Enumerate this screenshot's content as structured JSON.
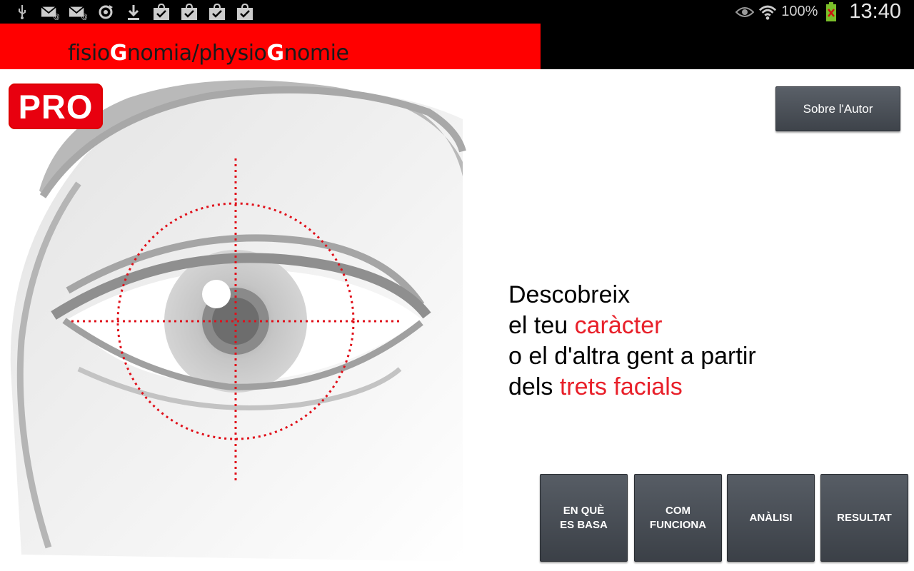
{
  "status_bar": {
    "left_icons": [
      "usb-icon",
      "email-icon",
      "email-icon",
      "sync-icon",
      "download-icon",
      "bag-check-icon",
      "bag-check-icon",
      "bag-check-icon",
      "bag-check-icon"
    ],
    "battery": "100%",
    "time": "13:40"
  },
  "header": {
    "title_parts": [
      "fisio",
      "G",
      "nomia/physio",
      "G",
      "nomie"
    ]
  },
  "badge": {
    "label": "PRO"
  },
  "about_button": {
    "label": "Sobre l'Autor"
  },
  "tagline": {
    "line1": "Descobreix",
    "line2_plain": "el teu ",
    "line2_highlight": "caràcter",
    "line3": "o el d'altra gent a partir",
    "line4_plain": "dels ",
    "line4_highlight": "trets facials"
  },
  "nav": {
    "basis": {
      "line1": "EN QUÈ",
      "line2": "ES BASA"
    },
    "how": {
      "line1": "COM",
      "line2": "FUNCIONA"
    },
    "analysis": {
      "label": "ANÀLISI"
    },
    "result": {
      "label": "RESULTAT"
    }
  },
  "colors": {
    "header_red": "#ff0000",
    "accent_red": "#e8202a",
    "button_gray": "#4a4f56"
  }
}
